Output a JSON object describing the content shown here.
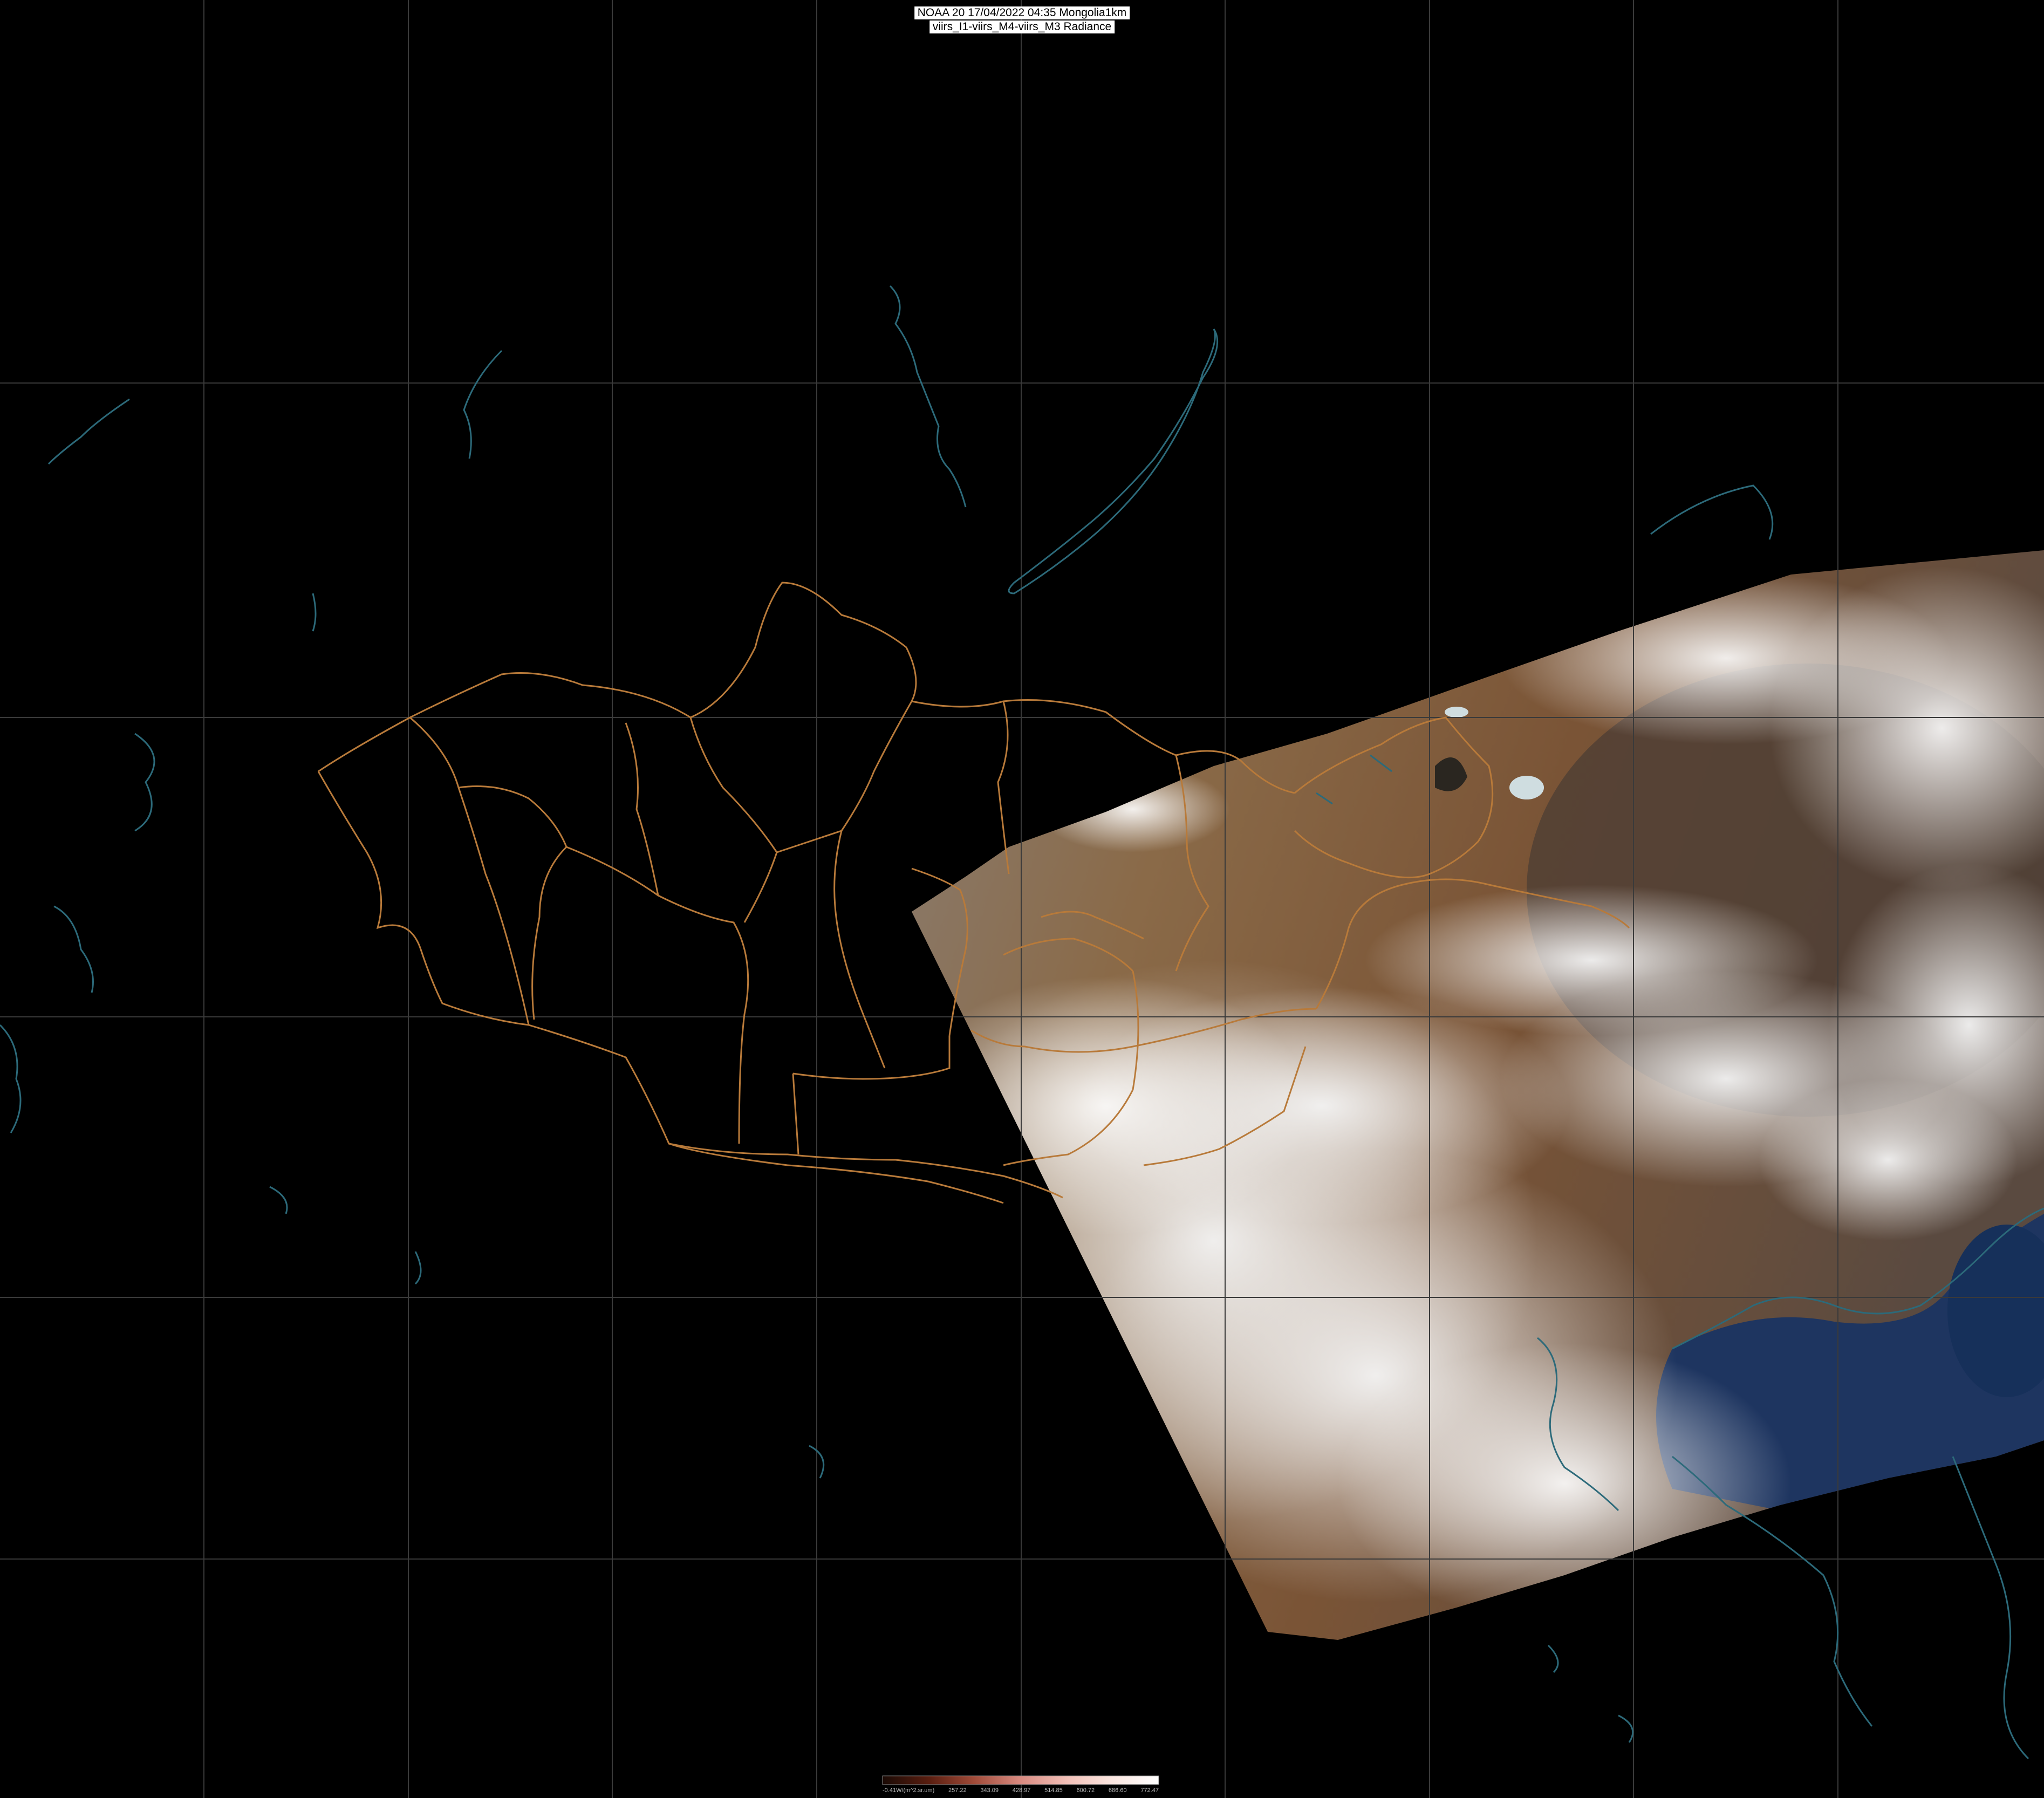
{
  "header": {
    "line1": "NOAA 20 17/04/2022 04:35 Mongolia1km",
    "line2": "viirs_I1-viirs_M4-viirs_M3 Radiance"
  },
  "legend": {
    "unit_label": "-0.41W/(m^2.sr.um)",
    "ticks": [
      "257.22",
      "343.09",
      "428.97",
      "514.85",
      "600.72",
      "686.60",
      "772.47"
    ],
    "colors": [
      "#1a0a05",
      "#5a1e10",
      "#a04a38",
      "#d98a80",
      "#f2c0b8",
      "#fbe6e0",
      "#ffffff"
    ]
  },
  "colors": {
    "background": "#000000",
    "gridline": "#3a3a3a",
    "coastline": "#2c6a7a",
    "admin_border": "#b87a3a",
    "land_brown": "#7a5a3a",
    "cloud_white": "#eeeeee",
    "sea_blue": "#1e3560"
  }
}
